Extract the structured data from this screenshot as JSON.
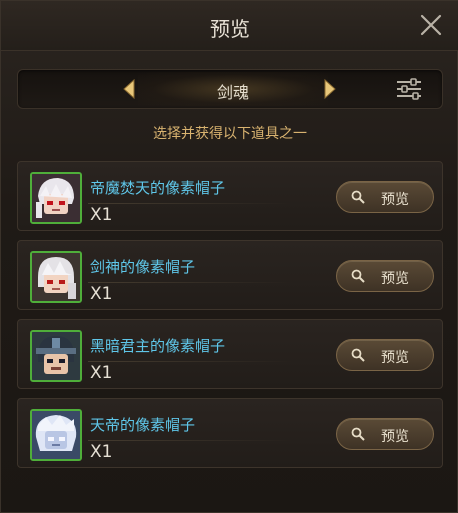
{
  "dialog": {
    "title": "预览"
  },
  "category": {
    "label": "剑魂"
  },
  "instruction": "选择并获得以下道具之一",
  "preview_label": "预览",
  "items": [
    {
      "name": "帝魔焚天的像素帽子",
      "quantity": "X1",
      "avatar": "white-hair-red-eyes-portrait"
    },
    {
      "name": "剑神的像素帽子",
      "quantity": "X1",
      "avatar": "white-hair-swordsman-portrait"
    },
    {
      "name": "黑暗君主的像素帽子",
      "quantity": "X1",
      "avatar": "dark-lord-helmet-portrait"
    },
    {
      "name": "天帝的像素帽子",
      "quantity": "X1",
      "avatar": "celestial-emperor-portrait"
    }
  ],
  "colors": {
    "item_name": "#5fc6e8",
    "instruction": "#d9b370",
    "avatar_border": "#4fae3a"
  },
  "icons": {
    "close": "close-icon",
    "left": "chevron-left-icon",
    "right": "chevron-right-icon",
    "filter": "filter-sliders-icon",
    "search": "search-icon"
  }
}
